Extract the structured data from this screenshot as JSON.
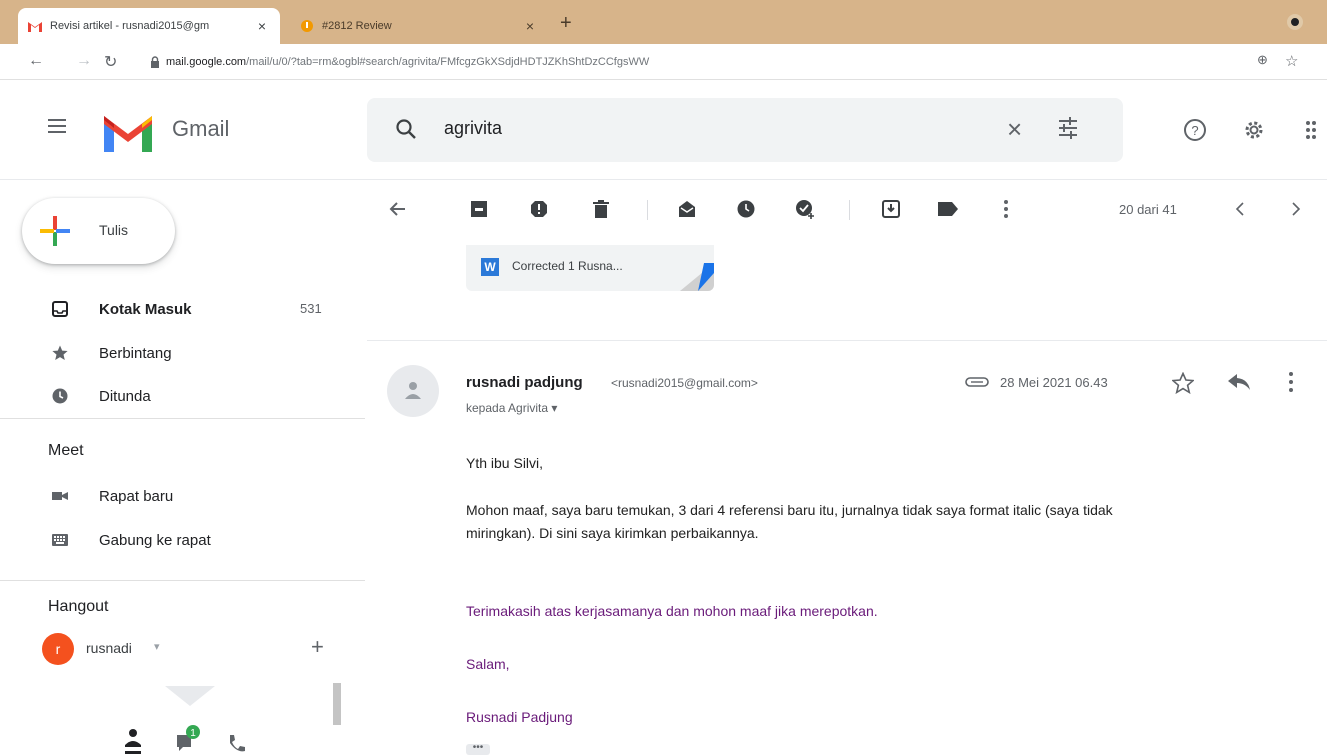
{
  "browser": {
    "tabs": [
      {
        "title": "Revisi artikel - rusnadi2015@gm",
        "close": "×"
      },
      {
        "title": "#2812 Review",
        "close": "×"
      }
    ],
    "new_tab": "+",
    "url_host": "mail.google.com",
    "url_path": "/mail/u/0/?tab=rm&ogbl#search/agrivita/FMfcgzGkXSdjdHDTJZKhShtDzCCfgsWW"
  },
  "gmail": {
    "app_name": "Gmail",
    "search": {
      "value": "agrivita",
      "clear": "×"
    },
    "compose_label": "Tulis",
    "nav": [
      {
        "label": "Kotak Masuk",
        "count": "531"
      },
      {
        "label": "Berbintang"
      },
      {
        "label": "Ditunda"
      }
    ],
    "meet": {
      "title": "Meet",
      "items": [
        {
          "label": "Rapat baru"
        },
        {
          "label": "Gabung ke rapat"
        }
      ]
    },
    "hangout": {
      "title": "Hangout",
      "user_initial": "r",
      "user": "rusnadi",
      "caret": "▾",
      "add": "+"
    },
    "toolbar": {
      "pager": "20 dari 41"
    },
    "attachment": {
      "badge": "W",
      "name": "Corrected 1 Rusna..."
    },
    "message": {
      "sender_name": "rusnadi padjung",
      "sender_email": "<rusnadi2015@gmail.com>",
      "recipient": "kepada Agrivita ▾",
      "date": "28 Mei 2021 06.43",
      "body": [
        "Yth ibu Silvi,",
        "Mohon maaf, saya baru temukan, 3 dari  4 referensi baru itu, jurnalnya tidak saya format italic (saya tidak",
        "miringkan). Di sini saya kirimkan perbaikannya.",
        "Terimakasih atas kerjasamanya dan mohon maaf jika merepotkan.",
        "Salam,",
        "Rusnadi Padjung"
      ],
      "ellipsis": "•••"
    }
  },
  "colors": {
    "tabstrip": "#d7b48a",
    "accent_purple": "#6a1b7a",
    "gmail_red": "#ea4335",
    "avatar_orange": "#f4511e"
  }
}
